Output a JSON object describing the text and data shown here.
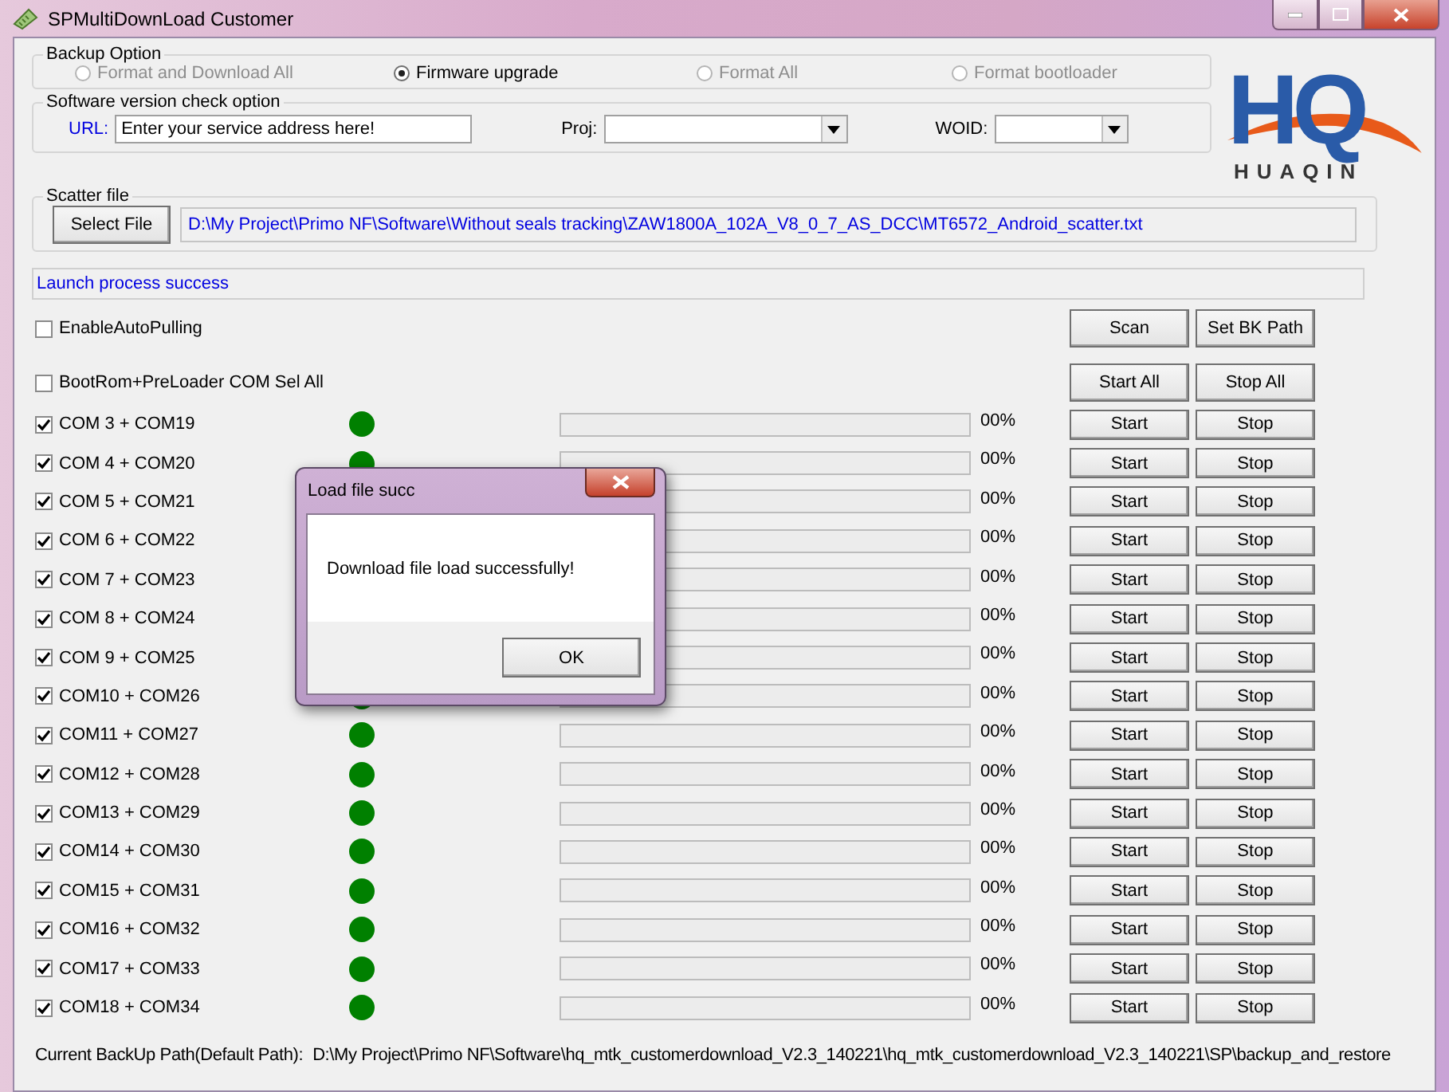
{
  "window": {
    "title": "SPMultiDownLoad Customer"
  },
  "backup_option": {
    "legend": "Backup Option",
    "options": [
      {
        "label": "Format and Download All",
        "selected": false,
        "disabled": true
      },
      {
        "label": "Firmware upgrade",
        "selected": true,
        "disabled": false
      },
      {
        "label": "Format All",
        "selected": false,
        "disabled": true
      },
      {
        "label": "Format bootloader",
        "selected": false,
        "disabled": true
      }
    ]
  },
  "version_check": {
    "legend": "Software version check option",
    "url_label": "URL:",
    "url_value": "Enter your service address here!",
    "proj_label": "Proj:",
    "woid_label": "WOID:"
  },
  "logo": {
    "mark": "HQ",
    "name": "HUAQIN"
  },
  "scatter": {
    "legend": "Scatter file",
    "button": "Select File",
    "path": "D:\\My Project\\Primo NF\\Software\\Without seals tracking\\ZAW1800A_102A_V8_0_7_AS_DCC\\MT6572_Android_scatter.txt"
  },
  "status": "Launch process success",
  "options": [
    {
      "label": "EnableAutoPulling",
      "checked": false,
      "buttons": [
        "Scan",
        "Set BK Path"
      ]
    },
    {
      "label": "BootRom+PreLoader COM Sel All",
      "checked": false,
      "buttons": [
        "Start All",
        "Stop All"
      ]
    }
  ],
  "ports": [
    {
      "label": "COM 3 + COM19",
      "checked": true,
      "level": 0,
      "reading": "00%",
      "start": "Start",
      "stop": "Stop"
    },
    {
      "label": "COM 4 + COM20",
      "checked": true,
      "level": 0,
      "reading": "00%",
      "start": "Start",
      "stop": "Stop"
    },
    {
      "label": "COM 5 + COM21",
      "checked": true,
      "level": 0,
      "reading": "00%",
      "start": "Start",
      "stop": "Stop"
    },
    {
      "label": "COM 6 + COM22",
      "checked": true,
      "level": 0,
      "reading": "00%",
      "start": "Start",
      "stop": "Stop"
    },
    {
      "label": "COM 7 + COM23",
      "checked": true,
      "level": 0,
      "reading": "00%",
      "start": "Start",
      "stop": "Stop"
    },
    {
      "label": "COM 8 + COM24",
      "checked": true,
      "level": 0,
      "reading": "00%",
      "start": "Start",
      "stop": "Stop"
    },
    {
      "label": "COM 9 + COM25",
      "checked": true,
      "level": 0,
      "reading": "00%",
      "start": "Start",
      "stop": "Stop"
    },
    {
      "label": "COM10 + COM26",
      "checked": true,
      "level": 0,
      "reading": "00%",
      "start": "Start",
      "stop": "Stop"
    },
    {
      "label": "COM11 + COM27",
      "checked": true,
      "level": 0,
      "reading": "00%",
      "start": "Start",
      "stop": "Stop"
    },
    {
      "label": "COM12 + COM28",
      "checked": true,
      "level": 0,
      "reading": "00%",
      "start": "Start",
      "stop": "Stop"
    },
    {
      "label": "COM13 + COM29",
      "checked": true,
      "level": 0,
      "reading": "00%",
      "start": "Start",
      "stop": "Stop"
    },
    {
      "label": "COM14 + COM30",
      "checked": true,
      "level": 0,
      "reading": "00%",
      "start": "Start",
      "stop": "Stop"
    },
    {
      "label": "COM15 + COM31",
      "checked": true,
      "level": 0,
      "reading": "00%",
      "start": "Start",
      "stop": "Stop"
    },
    {
      "label": "COM16 + COM32",
      "checked": true,
      "level": 0,
      "reading": "00%",
      "start": "Start",
      "stop": "Stop"
    },
    {
      "label": "COM17 + COM33",
      "checked": true,
      "level": 0,
      "reading": "00%",
      "start": "Start",
      "stop": "Stop"
    },
    {
      "label": "COM18 + COM34",
      "checked": true,
      "level": 0,
      "reading": "00%",
      "start": "Start",
      "stop": "Stop"
    }
  ],
  "footer": {
    "label": "Current BackUp Path(Default Path):",
    "path": "D:\\My Project\\Primo NF\\Software\\hq_mtk_customerdownload_V2.3_140221\\hq_mtk_customerdownload_V2.3_140221\\SP\\backup_and_restore"
  },
  "dialog": {
    "title": "Load file succ",
    "message": "Download file load successfully!",
    "button": "OK"
  }
}
